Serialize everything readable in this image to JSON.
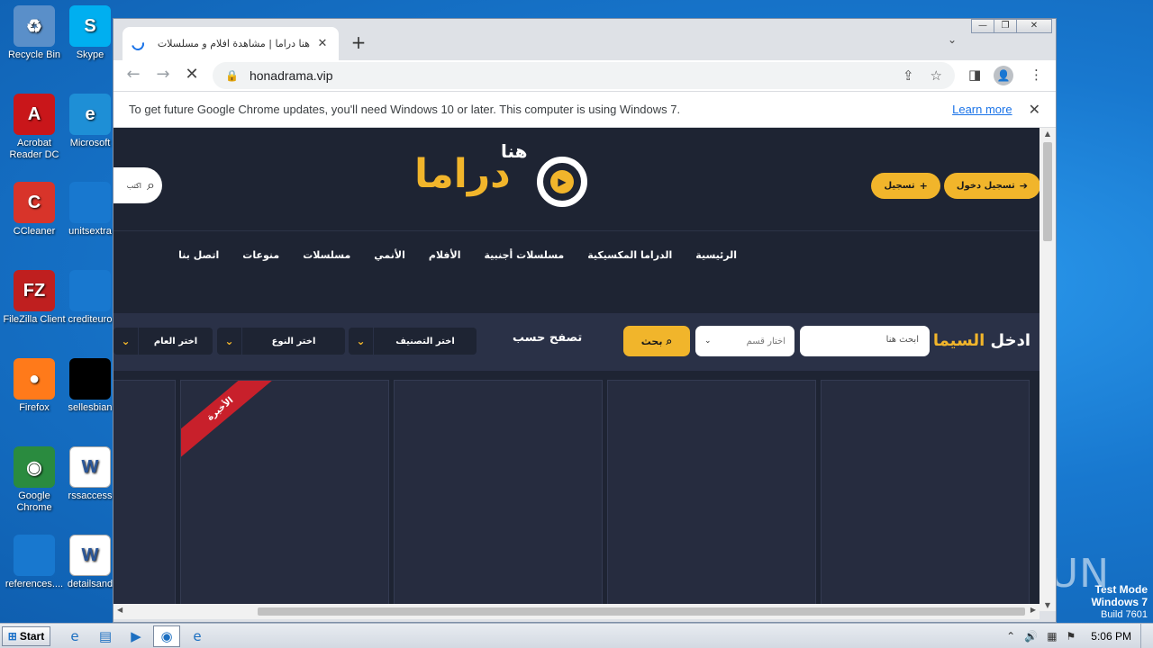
{
  "desktop": {
    "icons_left": [
      {
        "label": "Recycle Bin",
        "icon": "recycle-bin-icon",
        "color": "#5a8fc9",
        "glyph": "♻"
      },
      {
        "label": "Acrobat Reader DC",
        "icon": "acrobat-icon",
        "color": "#c9161a",
        "glyph": "A"
      },
      {
        "label": "CCleaner",
        "icon": "ccleaner-icon",
        "color": "#d8342a",
        "glyph": "C"
      },
      {
        "label": "FileZilla Client",
        "icon": "filezilla-icon",
        "color": "#bf1f1f",
        "glyph": "FZ"
      },
      {
        "label": "Firefox",
        "icon": "firefox-icon",
        "color": "#ff7a1a",
        "glyph": "●"
      },
      {
        "label": "Google Chrome",
        "icon": "chrome-icon",
        "color": "#2a8b3f",
        "glyph": "◉"
      },
      {
        "label": "references....",
        "icon": "file-icon",
        "color": "#1878cf",
        "glyph": ""
      }
    ],
    "icons_right": [
      {
        "label": "Skype",
        "icon": "skype-icon",
        "color": "#00aff0",
        "glyph": "S"
      },
      {
        "label": "Microsoft",
        "icon": "edge-icon",
        "color": "#1e8fd6",
        "glyph": "e"
      },
      {
        "label": "unitsextra",
        "icon": "file-icon",
        "color": "#1878cf",
        "glyph": ""
      },
      {
        "label": "crediteuro",
        "icon": "file-icon",
        "color": "#1878cf",
        "glyph": ""
      },
      {
        "label": "sellesbian",
        "icon": "black-file-icon",
        "color": "#000000",
        "glyph": ""
      },
      {
        "label": "rssaccess",
        "icon": "word-doc-icon",
        "color": "#ffffff",
        "glyph": "W"
      },
      {
        "label": "detailsand",
        "icon": "word-doc-icon",
        "color": "#ffffff",
        "glyph": "W"
      }
    ],
    "watermark": "ANY ▷ RUN",
    "test_mode": {
      "line1": "Test Mode",
      "line2": "Windows 7",
      "line3": "Build 7601"
    }
  },
  "browser": {
    "tab": {
      "title": "هنا دراما | مشاهدة افلام و مسلسلات",
      "close": "✕"
    },
    "new_tab": "+",
    "tab_search": "⌄",
    "window_controls": {
      "minimize": "—",
      "restore": "❐",
      "close": "✕"
    },
    "toolbar": {
      "back": "←",
      "forward": "→",
      "reload": "✕",
      "lock": "🔒",
      "url": "honadrama.vip",
      "share": "⇪",
      "star": "☆",
      "sidepanel": "◨",
      "profile": "👤",
      "menu": "⋮"
    },
    "infobar": {
      "message": "To get future Google Chrome updates, you'll need Windows 10 or later. This computer is using Windows 7.",
      "link": "Learn more",
      "close": "✕"
    }
  },
  "site": {
    "logo": {
      "main": "دراما",
      "sub": "هنا"
    },
    "search_placeholder": "اكتب",
    "auth": {
      "login": "تسجيل دخول",
      "register": "تسجيل"
    },
    "nav": [
      "الرئيسية",
      "الدراما المكسيكية",
      "مسلسلات أجنبية",
      "الأفلام",
      "الأنمي",
      "مسلسلات",
      "منوعات",
      "اتصل بنا"
    ],
    "filter": {
      "title_white": "ادخل",
      "title_yellow": "السيما",
      "search_placeholder": "ابحث هنا",
      "category_placeholder": "اختار قسم",
      "search_button": "بحث",
      "browse_label": "تصفح حسب",
      "dropdowns": [
        "اختر التصنيف",
        "اختر النوع",
        "اختر العام"
      ]
    },
    "ribbon": "الأخيرة"
  },
  "taskbar": {
    "start": "Start",
    "apps": [
      {
        "icon": "ie-icon",
        "glyph": "e",
        "active": false
      },
      {
        "icon": "folder-icon",
        "glyph": "▤",
        "active": false
      },
      {
        "icon": "media-player-icon",
        "glyph": "▶",
        "active": false
      },
      {
        "icon": "chrome-taskbar-icon",
        "glyph": "◉",
        "active": true
      },
      {
        "icon": "edge-taskbar-icon",
        "glyph": "e",
        "active": false
      }
    ],
    "tray": {
      "chevron": "⌃",
      "volume": "🔊",
      "network": "▦",
      "flag": "⚑",
      "time": "5:06 PM"
    }
  }
}
